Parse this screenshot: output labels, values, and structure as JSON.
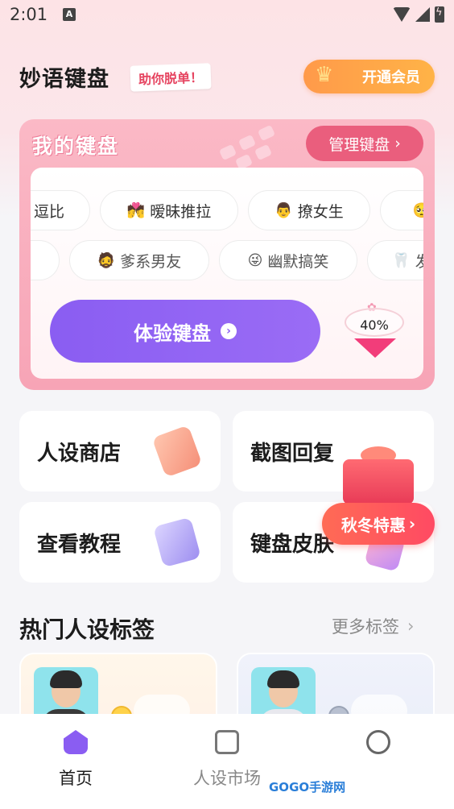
{
  "status_bar": {
    "time": "2:01",
    "notif_icon": "A"
  },
  "header": {
    "app_title": "妙语键盘",
    "slogan": "助你脱单！",
    "vip_button": "开通会员"
  },
  "keyboard_card": {
    "title": "我的键盘",
    "manage_button": "管理键盘",
    "tags_row1": [
      {
        "emoji": "",
        "label": "逗比"
      },
      {
        "emoji": "💏",
        "label": "暧昧推拉"
      },
      {
        "emoji": "👨",
        "label": "撩女生"
      },
      {
        "emoji": "🥺",
        "label": ""
      }
    ],
    "tags_row2": [
      {
        "emoji": "",
        "label": ""
      },
      {
        "emoji": "🧔",
        "label": "爹系男友"
      },
      {
        "emoji": "😜",
        "label": "幽默搞笑"
      },
      {
        "emoji": "🦷",
        "label": "发"
      }
    ],
    "try_button": "体验键盘",
    "progress_percent": "40%",
    "progress_value": 0.4
  },
  "grid": [
    {
      "label": "人设商店",
      "icon": "tag-icon"
    },
    {
      "label": "截图回复",
      "icon": "image-icon"
    },
    {
      "label": "查看教程",
      "icon": "book-icon"
    },
    {
      "label": "键盘皮肤",
      "icon": "palette-icon"
    }
  ],
  "promo": {
    "label": "秋冬特惠"
  },
  "hot_tags": {
    "title": "热门人设标签",
    "more": "更多标签"
  },
  "bottom_nav": [
    {
      "label": "首页",
      "icon": "home-icon",
      "active": true
    },
    {
      "label": "人设市场",
      "icon": "store-icon",
      "active": false
    },
    {
      "label": "",
      "icon": "face-icon",
      "active": false
    }
  ],
  "watermark": "GOGO手游网",
  "colors": {
    "accent": "#8a5df2",
    "pink": "#ea5e7d",
    "promo": "#ff5a5f"
  }
}
